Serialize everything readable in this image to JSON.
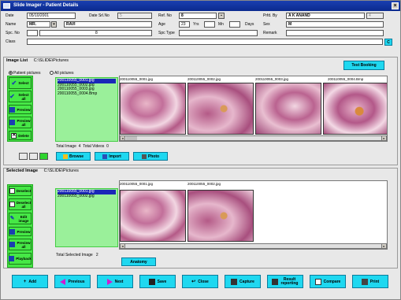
{
  "window": {
    "title": "Slide Imager - Patient Details",
    "close": "×"
  },
  "patient": {
    "date_label": "Date",
    "date_value": "05/10/2001",
    "date_srl_label": "Date Srl.No",
    "date_srl_value": "5",
    "ref_no_label": "Ref. No",
    "ref_no_value": "8",
    "prfd_by_label": "Prfd. By",
    "prfd_by_value": "A K ANAND",
    "prfd_by_code": "4",
    "name_label": "Name",
    "name_title": "MR.",
    "name_value": "RAVI",
    "age_label": "Age",
    "age_value": "23",
    "yrs_label": "Yrs",
    "mn_label": "Mn",
    "days_label": "Days",
    "sex_label": "Sex",
    "sex_value": "M",
    "spc_no_label": "Spc. No",
    "spc_no_value": "8",
    "spc_type_label": "Spc Type",
    "remark_label": "Remark",
    "class_label": "Class",
    "class_btn": "C"
  },
  "image_list": {
    "title": "Image List",
    "path": "C:\\SLIDE\\Pictures",
    "test_booking": "Test Booking",
    "radio_patient": "Patient pictures",
    "radio_all": "All pictures",
    "buttons": [
      "Select",
      "Select all",
      "Preview",
      "Preview all",
      "Delete"
    ],
    "files": [
      "200110055_0001.jpg",
      "200110055_0002.jpg",
      "200110055_0003.jpg",
      "200110055_0004.Bmp"
    ],
    "thumb_captions": [
      "200110055_0001.jpg",
      "200110055_0002.jpg",
      "200110055_0003.jpg",
      "200110055_0004.Bmp"
    ],
    "total_image_label": "Total Image",
    "total_image_value": "4",
    "total_videos_label": "Total Videos",
    "total_videos_value": "0",
    "actions": [
      "Browse",
      "Import",
      "Photo"
    ]
  },
  "selected_image": {
    "title": "Selected Image",
    "path": "C:\\SLIDE\\Pictures",
    "buttons": [
      "Deselect",
      "Deselect all",
      "Edit image",
      "Preview",
      "Preview all",
      "Playback"
    ],
    "files": [
      "200110055_0001.jpg",
      "200110055_0002.jpg"
    ],
    "thumb_captions": [
      "200110055_0001.jpg",
      "200110055_0002.jpg"
    ],
    "total_selected_label": "Total Selected Image",
    "total_selected_value": "2",
    "anatomy": "Anatomy"
  },
  "bottom_buttons": [
    "Add",
    "Previous",
    "Next",
    "Save",
    "Close",
    "Capture",
    "Result reporting",
    "Compare",
    "Print"
  ]
}
